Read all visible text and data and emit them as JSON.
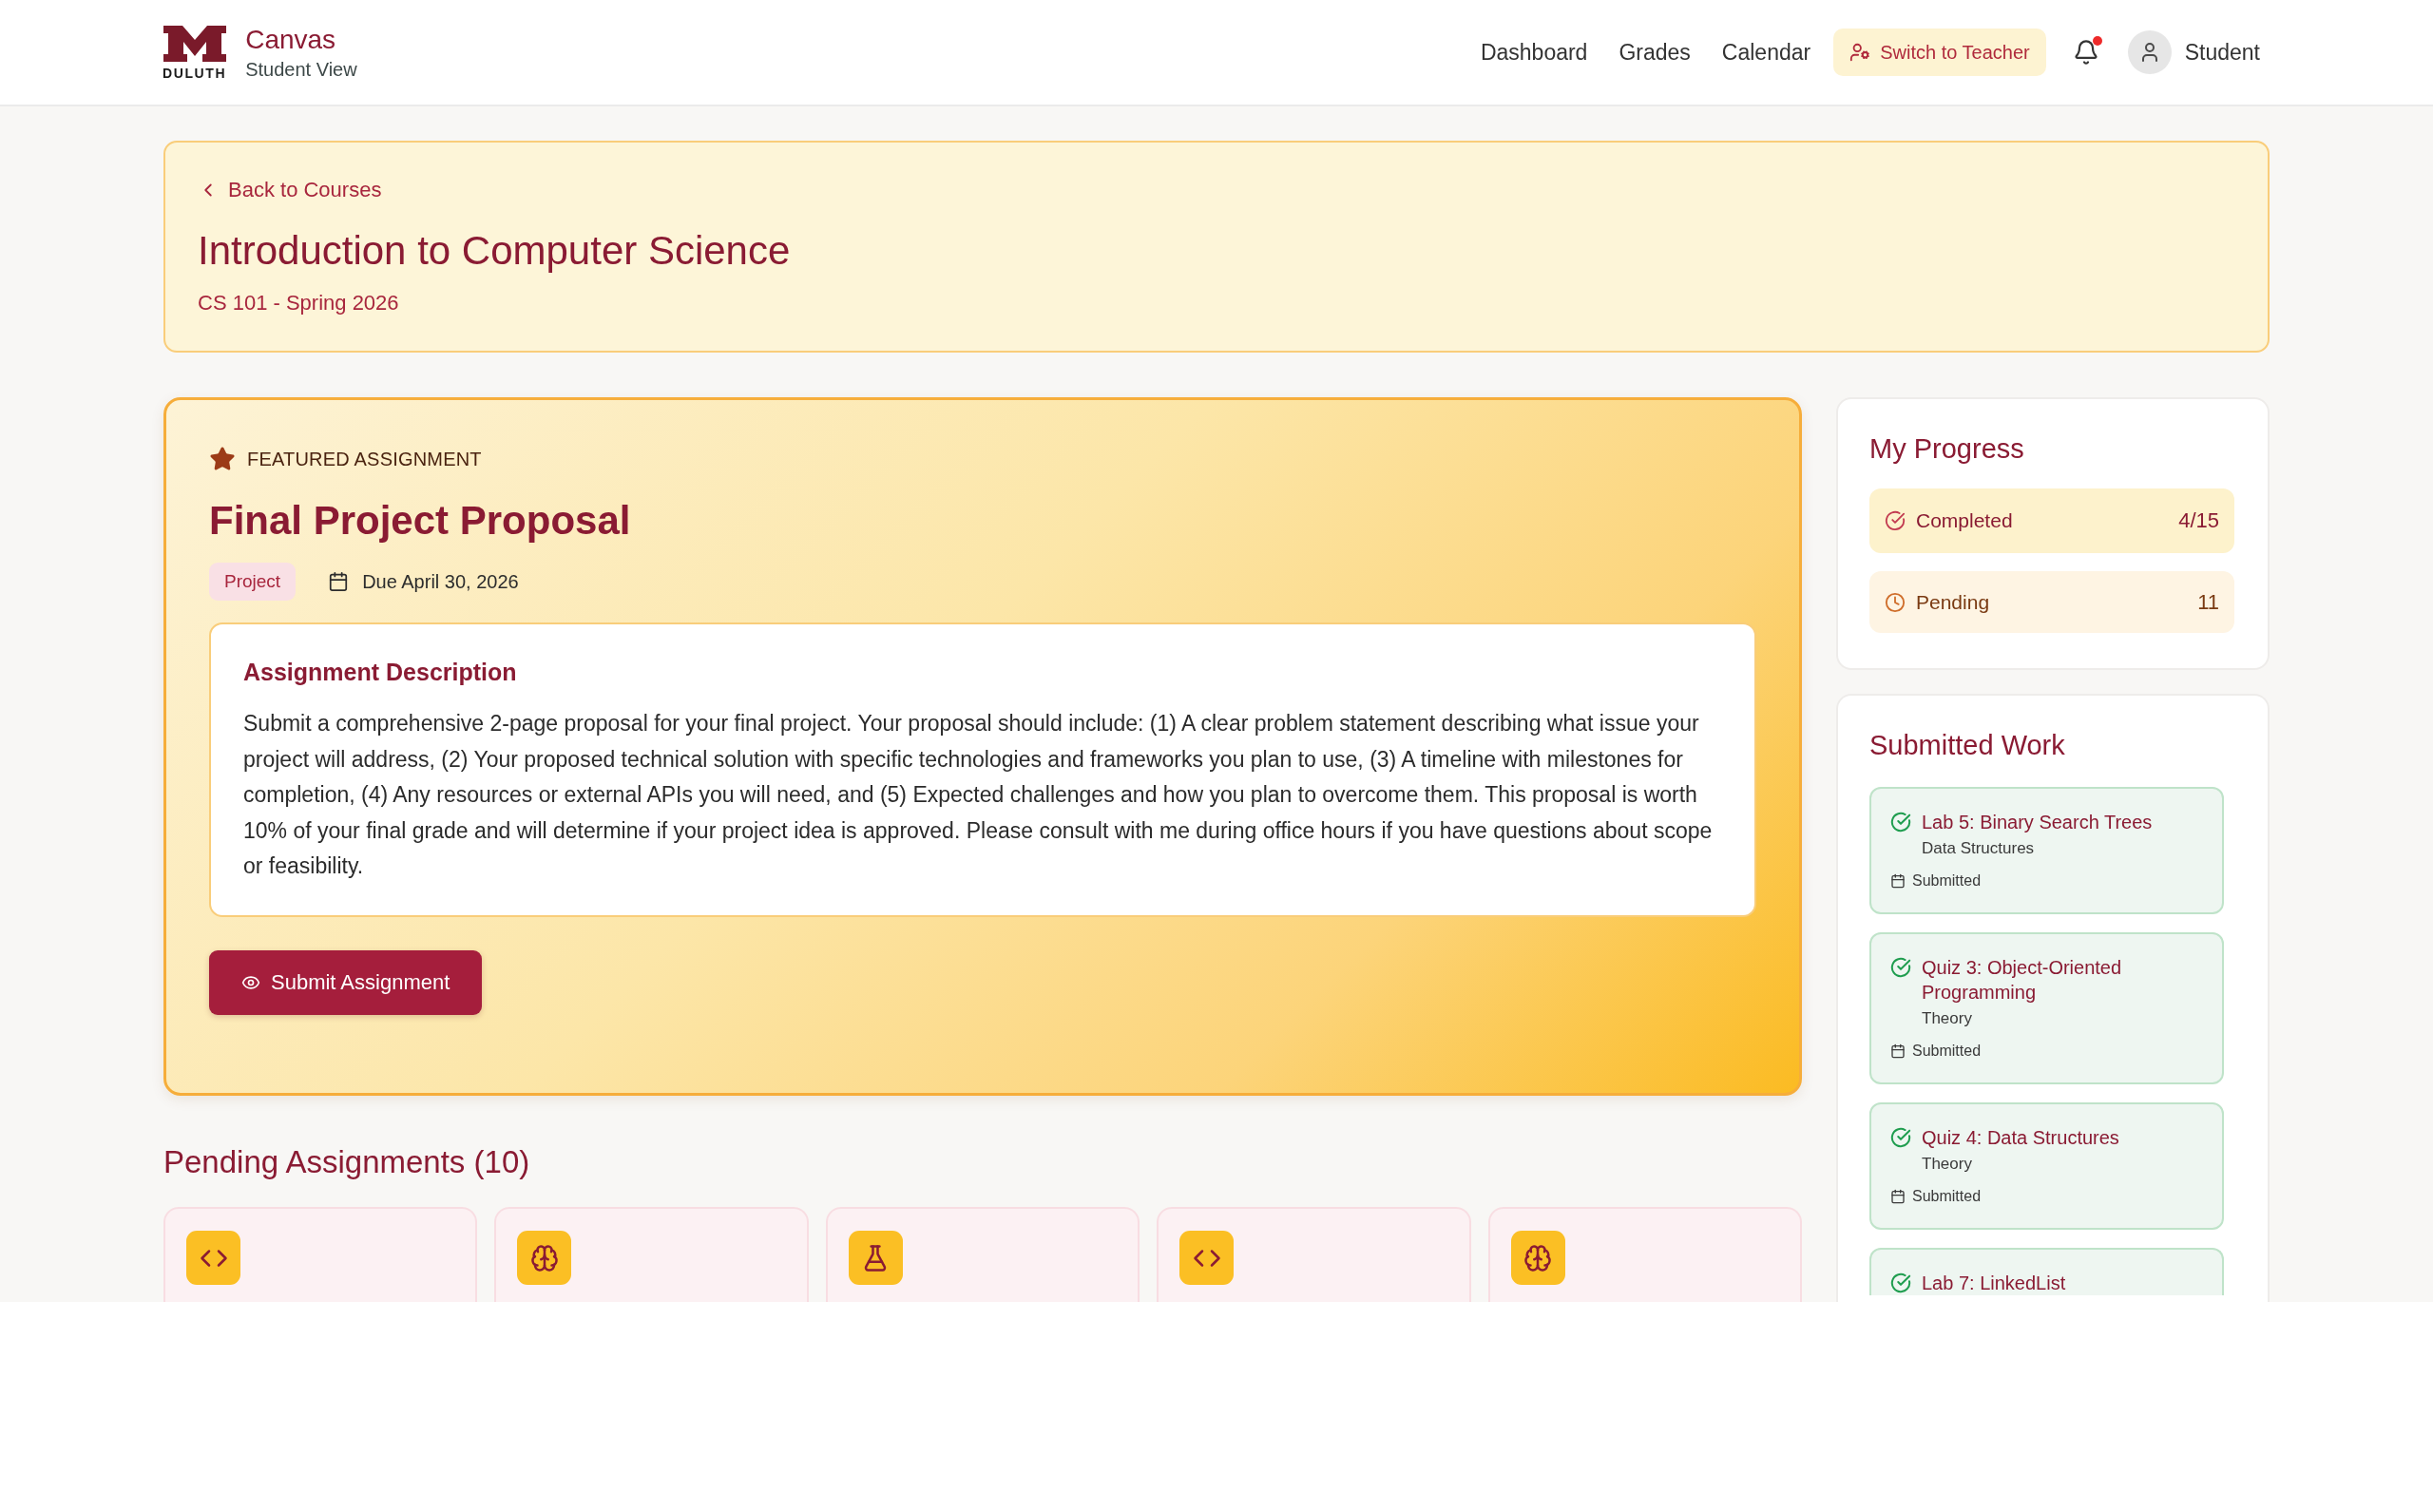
{
  "header": {
    "logo": {
      "wordmark": "DULUTH"
    },
    "app_name": "Canvas",
    "view_label": "Student View",
    "nav": [
      "Dashboard",
      "Grades",
      "Calendar"
    ],
    "switch_button": "Switch to Teacher",
    "notifications": {
      "unread": true
    },
    "user": "Student"
  },
  "course": {
    "back_link": "Back to Courses",
    "title": "Introduction to Computer Science",
    "subtitle": "CS 101 - Spring 2026"
  },
  "featured": {
    "eyebrow": "FEATURED ASSIGNMENT",
    "title": "Final Project Proposal",
    "tag": "Project",
    "due": "Due April 30, 2026",
    "description": {
      "heading": "Assignment Description",
      "body": "Submit a comprehensive 2-page proposal for your final project. Your proposal should include: (1) A clear problem statement describing what issue your project will address, (2) Your proposed technical solution with specific technologies and frameworks you plan to use, (3) A timeline with milestones for completion, (4) Any resources or external APIs you will need, and (5) Expected challenges and how you plan to overcome them. This proposal is worth 10% of your final grade and will determine if your project idea is approved. Please consult with me during office hours if you have questions about scope or feasibility."
    },
    "button": "Submit Assignment"
  },
  "pending": {
    "heading": "Pending Assignments (10)",
    "cards": [
      {
        "kind": "code"
      },
      {
        "kind": "theory"
      },
      {
        "kind": "lab"
      },
      {
        "kind": "code"
      },
      {
        "kind": "theory"
      }
    ]
  },
  "progress": {
    "heading": "My Progress",
    "stats": [
      {
        "kind": "completed",
        "label": "Completed",
        "value": "4/15"
      },
      {
        "kind": "pending",
        "label": "Pending",
        "value": "11"
      }
    ]
  },
  "submitted": {
    "heading": "Submitted Work",
    "items": [
      {
        "title": "Lab 5: Binary Search Trees",
        "category": "Data Structures",
        "status": "Submitted"
      },
      {
        "title": "Quiz 3: Object-Oriented Programming",
        "category": "Theory",
        "status": "Submitted"
      },
      {
        "title": "Quiz 4: Data Structures",
        "category": "Theory",
        "status": "Submitted"
      },
      {
        "title": "Lab 7: LinkedList"
      }
    ]
  }
}
